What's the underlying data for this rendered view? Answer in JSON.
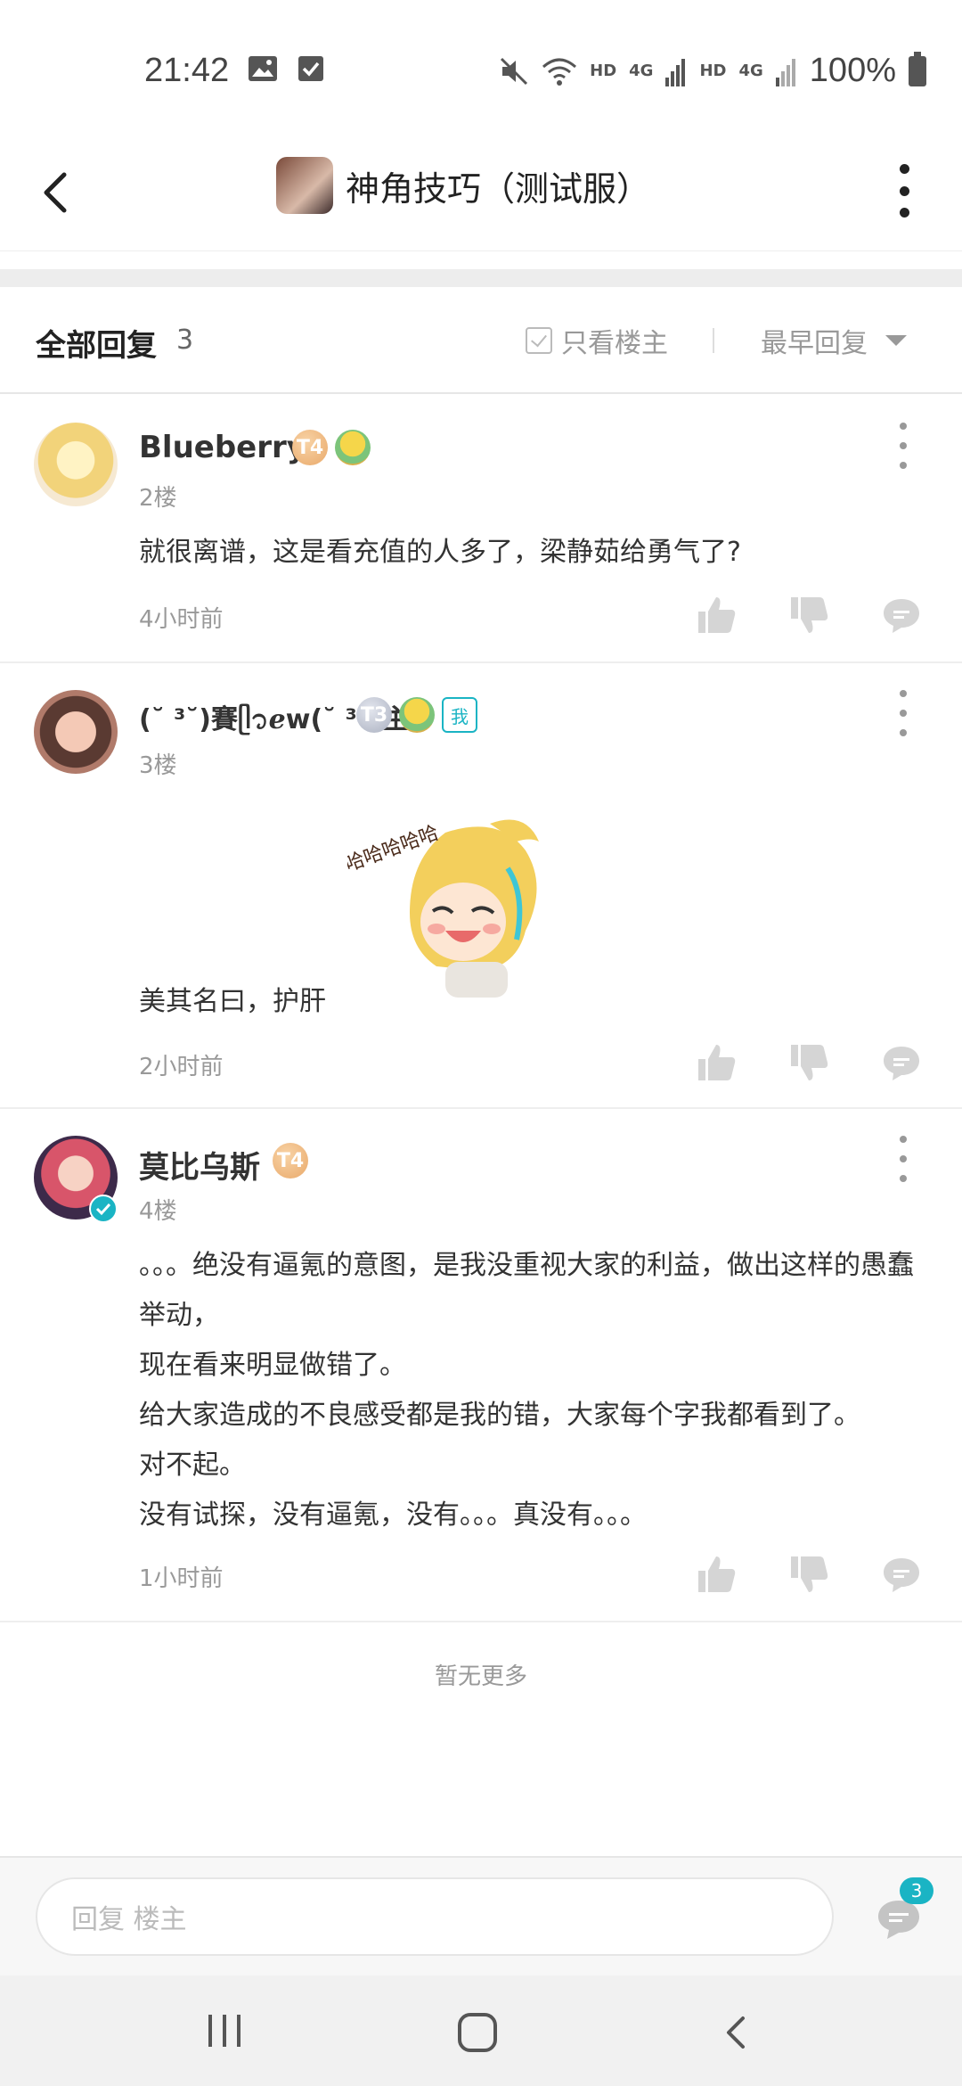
{
  "status": {
    "time": "21:42",
    "network_1": "HD",
    "network_gen_1": "4G",
    "network_2": "HD",
    "network_gen_2": "4G",
    "battery": "100%"
  },
  "header": {
    "title": "神角技巧（测试服）"
  },
  "filter": {
    "title": "全部回复",
    "count": "3",
    "only_host": "只看楼主",
    "sort": "最早回复"
  },
  "comments": [
    {
      "name": "Blueberry",
      "level": "T4",
      "floor": "2楼",
      "lines": [
        "就很离谱，这是看充值的人多了，梁静茹给勇气了?"
      ],
      "time": "4小时前"
    },
    {
      "name": "(˘ ³˘)賽ᥫ᭡ℯw(˘ ³˘)主",
      "level": "T3",
      "me_badge": "我",
      "floor": "3楼",
      "lines": [
        "美其名曰，护肝"
      ],
      "sticker_text": "哈哈哈哈哈",
      "time": "2小时前"
    },
    {
      "name": "莫比乌斯",
      "level": "T4",
      "floor": "4楼",
      "lines": [
        "。。。绝没有逼氪的意图，是我没重视大家的利益，做出这样的愚蠢举动，",
        "现在看来明显做错了。",
        "给大家造成的不良感受都是我的错，大家每个字我都看到了。",
        "对不起。",
        "没有试探，没有逼氪，没有。。。真没有。。。"
      ],
      "time": "1小时前"
    }
  ],
  "footer": {
    "no_more": "暂无更多",
    "reply_placeholder": "回复  楼主",
    "reply_count": "3"
  },
  "colors": {
    "accent": "#1ab4c4",
    "gold_badge": "#e9a96a",
    "silver_badge": "#aab0c0"
  }
}
